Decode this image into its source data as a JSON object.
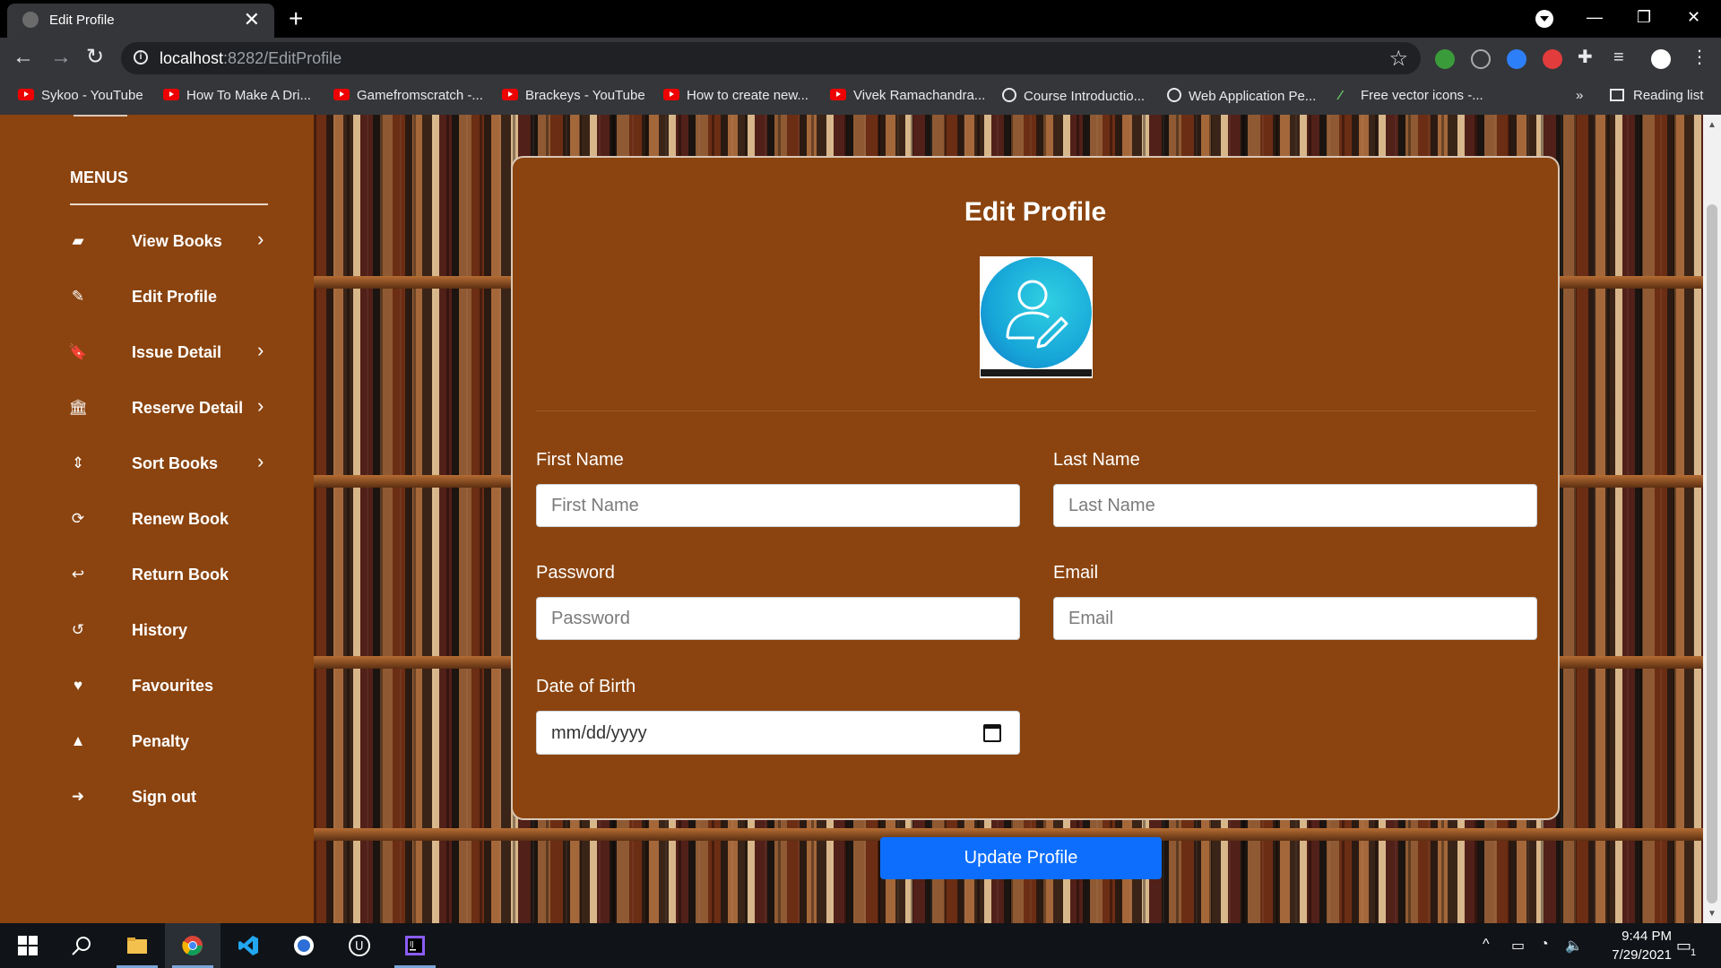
{
  "browser": {
    "tab_title": "Edit Profile",
    "tab_close": "✕",
    "new_tab": "+",
    "url_host": "localhost",
    "url_path": ":8282/EditProfile",
    "bookmarks": [
      {
        "label": "Sykoo - YouTube",
        "icon": "youtube-icon"
      },
      {
        "label": "How To Make A Dri...",
        "icon": "youtube-icon"
      },
      {
        "label": "Gamefromscratch -...",
        "icon": "youtube-icon"
      },
      {
        "label": "Brackeys - YouTube",
        "icon": "youtube-icon"
      },
      {
        "label": "How to create new...",
        "icon": "youtube-icon"
      },
      {
        "label": "Vivek Ramachandra...",
        "icon": "youtube-icon"
      },
      {
        "label": "Course Introductio...",
        "icon": "globe-icon"
      },
      {
        "label": "Web Application Pe...",
        "icon": "globe-icon"
      },
      {
        "label": "Free vector icons -...",
        "icon": "pen-icon"
      }
    ],
    "more_bookmarks": "»",
    "reading_list": "Reading list"
  },
  "sidebar": {
    "title": "MENUS",
    "items": [
      {
        "label": "View Books",
        "icon": "book-icon",
        "glyph": "▰",
        "chevron": "›"
      },
      {
        "label": "Edit Profile",
        "icon": "edit-icon",
        "glyph": "✎",
        "chevron": ""
      },
      {
        "label": "Issue Detail",
        "icon": "bookmark-icon",
        "glyph": "🔖",
        "chevron": "›"
      },
      {
        "label": "Reserve Detail",
        "icon": "bank-icon",
        "glyph": "🏛",
        "chevron": "›"
      },
      {
        "label": "Sort Books",
        "icon": "sort-icon",
        "glyph": "⇕",
        "chevron": "›"
      },
      {
        "label": "Renew Book",
        "icon": "refresh-icon",
        "glyph": "⟳",
        "chevron": ""
      },
      {
        "label": "Return Book",
        "icon": "reply-icon",
        "glyph": "↩",
        "chevron": ""
      },
      {
        "label": "History",
        "icon": "history-icon",
        "glyph": "↺",
        "chevron": ""
      },
      {
        "label": "Favourites",
        "icon": "heart-icon",
        "glyph": "♥",
        "chevron": ""
      },
      {
        "label": "Penalty",
        "icon": "warning-icon",
        "glyph": "▲",
        "chevron": ""
      },
      {
        "label": "Sign out",
        "icon": "sign-out-icon",
        "glyph": "➜",
        "chevron": ""
      }
    ]
  },
  "form": {
    "title": "Edit Profile",
    "first_name_label": "First Name",
    "first_name_placeholder": "First Name",
    "last_name_label": "Last Name",
    "last_name_placeholder": "Last Name",
    "password_label": "Password",
    "password_placeholder": "Password",
    "email_label": "Email",
    "email_placeholder": "Email",
    "dob_label": "Date of Birth",
    "dob_placeholder": "mm/dd/yyyy",
    "submit_label": "Update Profile"
  },
  "taskbar": {
    "time": "9:44 PM",
    "date": "7/29/2021",
    "notification_count": "1"
  },
  "colors": {
    "sidebar_bg": "#8b440f",
    "card_bg": "#8b440f",
    "primary_button": "#0d6efd"
  }
}
